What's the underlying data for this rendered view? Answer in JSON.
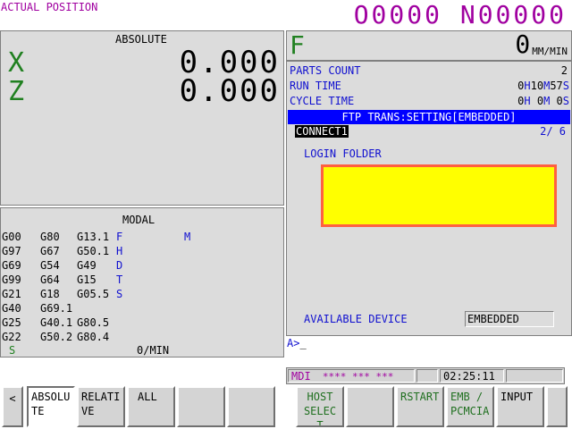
{
  "header": {
    "screen_title": "ACTUAL POSITION",
    "program_number": "O0000",
    "sequence_number": "N00000"
  },
  "position": {
    "title": "ABSOLUTE",
    "axes": [
      {
        "label": "X",
        "value": "0.000"
      },
      {
        "label": "Z",
        "value": "0.000"
      }
    ]
  },
  "modal": {
    "title": "MODAL",
    "rows": [
      [
        "G00",
        "G80",
        "G13.1",
        "F",
        "M"
      ],
      [
        "G97",
        "G67",
        "G50.1",
        "H",
        ""
      ],
      [
        "G69",
        "G54",
        "G49",
        "D",
        ""
      ],
      [
        "G99",
        "G64",
        "G15",
        "T",
        ""
      ],
      [
        "G21",
        "G18",
        "G05.5",
        "S",
        ""
      ],
      [
        "G40",
        "G69.1",
        "",
        "",
        ""
      ],
      [
        "G25",
        "G40.1",
        "G80.5",
        "",
        ""
      ],
      [
        "G22",
        "G50.2",
        "G80.4",
        "",
        ""
      ]
    ],
    "s_label": "S",
    "feed_unit": "0/MIN"
  },
  "feed": {
    "label": "F",
    "value": "0",
    "unit": "MM/MIN"
  },
  "counters": {
    "parts_count_label": "PARTS COUNT",
    "parts_count_value": "2",
    "run_time_label": "RUN TIME",
    "run_time_h": "0",
    "run_time_m": "10",
    "run_time_s": "57",
    "cycle_time_label": "CYCLE TIME",
    "cycle_time_h": "0",
    "cycle_time_m": "0",
    "cycle_time_s": "0",
    "unit_h": "H",
    "unit_m": "M",
    "unit_s": "S"
  },
  "ftp": {
    "banner": "FTP TRANS:SETTING[EMBEDDED]",
    "connection": "CONNECT1",
    "page": "2/ 6",
    "login_folder_label": "LOGIN FOLDER",
    "login_folder_value": "",
    "available_device_label": "AVAILABLE DEVICE",
    "available_device_value": "EMBEDDED"
  },
  "input_line": {
    "prompt": "A>",
    "value": "_"
  },
  "status": {
    "mode": "MDI",
    "stars": "**** *** ***",
    "time": "02:25:11"
  },
  "softkeys": {
    "left_arrow": "<",
    "absolute": "ABSOLUTE",
    "relative": "RELATIVE",
    "all": "ALL",
    "host_select": "HOST SELECT",
    "rstart": "RSTART",
    "emb_pcmcia": "EMB / PCMCIA",
    "input": "INPUT"
  },
  "colors": {
    "title_purple": "#a000a0",
    "label_blue": "#1010d0",
    "axis_green": "#208020",
    "banner_blue": "#0000ff",
    "folder_yellow": "#ffff00",
    "folder_border": "#ff6040"
  }
}
